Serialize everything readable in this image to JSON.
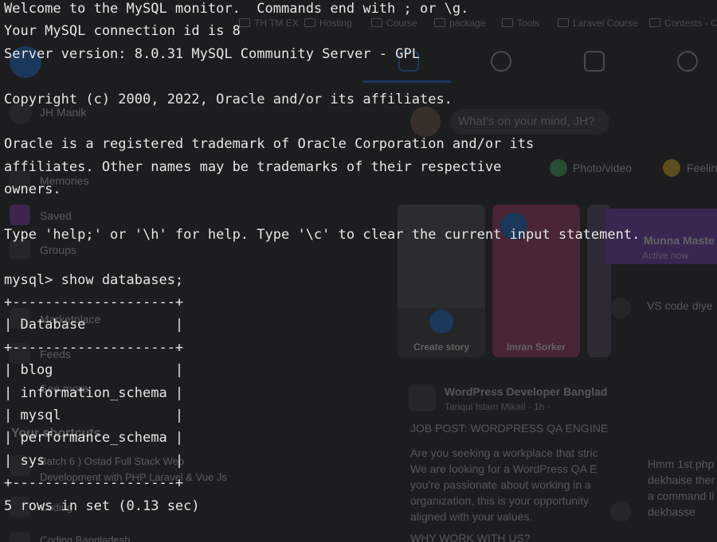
{
  "terminal": {
    "lines": [
      "Welcome to the MySQL monitor.  Commands end with ; or \\g.",
      "Your MySQL connection id is 8",
      "Server version: 8.0.31 MySQL Community Server - GPL",
      "",
      "Copyright (c) 2000, 2022, Oracle and/or its affiliates.",
      "",
      "Oracle is a registered trademark of Oracle Corporation and/or its",
      "affiliates. Other names may be trademarks of their respective",
      "owners.",
      "",
      "Type 'help;' or '\\h' for help. Type '\\c' to clear the current input statement.",
      "",
      "mysql> show databases;",
      "+--------------------+",
      "| Database           |",
      "+--------------------+",
      "| blog               |",
      "| information_schema |",
      "| mysql              |",
      "| performance_schema |",
      "| sys                |",
      "+--------------------+",
      "5 rows in set (0.13 sec)"
    ],
    "text_color": "#e6e6e6",
    "background_color": "#1c1d1e"
  },
  "background_window": {
    "bookmarks": [
      "TH TM EX",
      "Hosting",
      "Course",
      "package",
      "Tools",
      "Laravel Course",
      "Contests - C"
    ],
    "sidebar": [
      "JH Manik",
      "Memories",
      "Saved",
      "Groups",
      "Marketplace",
      "Feeds",
      "See more",
      "Your shortcuts",
      "Batch 6 ) Ostad Full Stack Web",
      "Development with PHP Laravel & Vue Js",
      "Coding",
      "Coding Bangladesh"
    ],
    "composer_placeholder": "What's on your mind, JH?",
    "composer_actions": [
      "Photo/video",
      "Feeling"
    ],
    "stories": [
      "Create story",
      "Imran Sorker"
    ],
    "post": {
      "group": "WordPress Developer Banglad",
      "author": "Tariqul Islam Mikail · 1h ·",
      "headline": "JOB POST: WORDPRESS QA ENGINE",
      "body": [
        "Are you seeking a workplace that stric",
        "We are looking for a WordPress QA E",
        "you're passionate about working in a",
        "organization, this is your opportunity",
        "aligned with your values."
      ],
      "subhead": "WHY WORK WITH US?"
    },
    "chat": {
      "name": "Munna Maste",
      "status": "Active now",
      "messages": [
        "VS code diye",
        "Hmm 1st php",
        "dekhaise ther",
        "a command li",
        "dekhasse"
      ]
    },
    "accent_color": "#1b74e4"
  }
}
